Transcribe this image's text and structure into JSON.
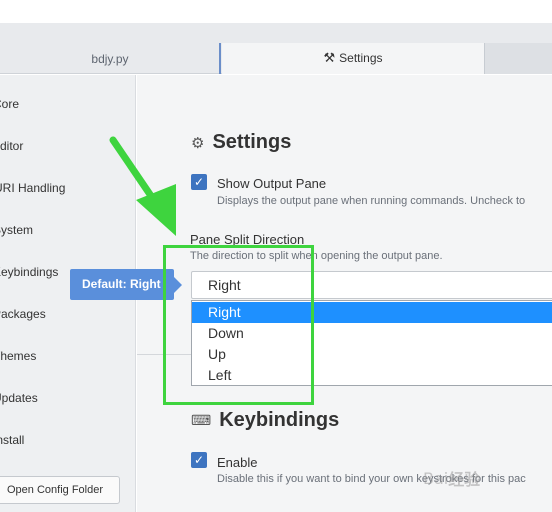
{
  "tabs": [
    {
      "label": "bdjy.py"
    },
    {
      "label": "Settings",
      "icon": "tools-icon"
    },
    {
      "label": ""
    }
  ],
  "sidebar": {
    "items": [
      {
        "label": "Core"
      },
      {
        "label": "Editor"
      },
      {
        "label": "URI Handling"
      },
      {
        "label": "System"
      },
      {
        "label": "Keybindings"
      },
      {
        "label": "Packages"
      },
      {
        "label": "Themes"
      },
      {
        "label": "Updates"
      },
      {
        "label": "Install"
      }
    ],
    "open_config_label": "Open Config Folder"
  },
  "settings": {
    "heading": "Settings",
    "show_output_pane": {
      "checked": true,
      "label": "Show Output Pane",
      "hint": "Displays the output pane when running commands. Uncheck to"
    },
    "pane_split": {
      "label": "Pane Split Direction",
      "hint": "The direction to split when opening the output pane.",
      "selected": "Right",
      "options": [
        "Right",
        "Down",
        "Up",
        "Left"
      ],
      "tooltip": "Default: Right"
    }
  },
  "keybindings": {
    "heading": "Keybindings",
    "enable": {
      "checked": true,
      "label": "Enable",
      "hint": "Disable this if you want to bind your own keystrokes for this pac"
    }
  },
  "watermark": {
    "text": "Bai",
    "brand": "经验"
  },
  "colors": {
    "accent": "#3d74c0",
    "selected_option": "#1e90ff",
    "highlight": "#3ed43e",
    "tooltip": "#5a8fdb"
  }
}
